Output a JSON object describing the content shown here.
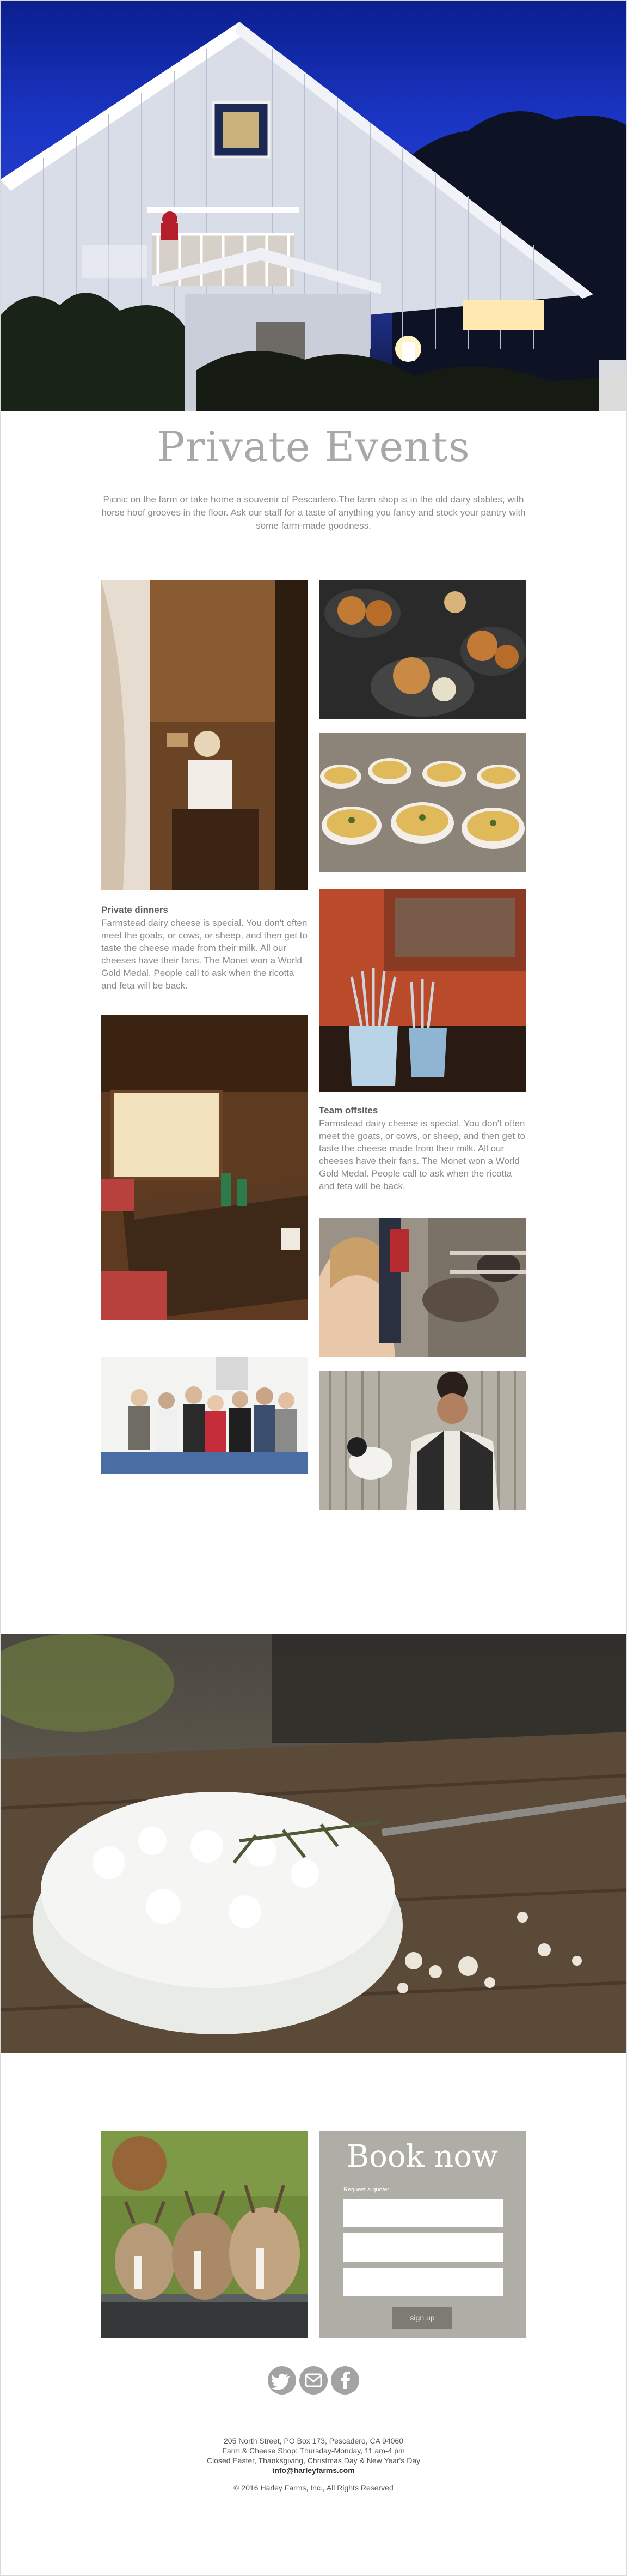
{
  "page": {
    "title": "Private Events",
    "intro": "Picnic on the farm or take home a souvenir of Pescadero.The farm shop is in the old dairy stables, with horse hoof grooves in the floor. Ask our staff for a taste of anything you fancy and stock your pantry with some farm-made goodness."
  },
  "cards": [
    {
      "title": "Private dinners",
      "text": "Farmstead dairy cheese is special. You don't often meet the goats, or cows, or sheep, and then get to taste the cheese made from their milk. All our cheeses have their fans. The Monet won a World Gold Medal. People call to ask when the ricotta and feta will be back."
    },
    {
      "title": "Team offsites",
      "text": "Farmstead dairy cheese is special. You don't often meet the goats, or cows, or sheep, and then get to taste the cheese made from their milk. All our cheeses have their fans. The Monet won a World Gold Medal. People call to ask when the ricotta and feta will be back."
    }
  ],
  "booking": {
    "title": "Book now",
    "label": "Request a quote:",
    "button": "sign up"
  },
  "social": [
    "twitter-icon",
    "mail-icon",
    "facebook-icon"
  ],
  "footer": {
    "line1": "205 North Street, PO Box 173, Pescadero, CA 94060",
    "line2": "Farm & Cheese Shop: Thursday-Monday, 11 am-4 pm",
    "line3": "Closed Easter, Thanksgiving, Christmas Day & New Year's Day",
    "email": "info@harleyfarms.com",
    "copyright": "© 2016 Harley Farms, Inc., All Rights Reserved"
  }
}
